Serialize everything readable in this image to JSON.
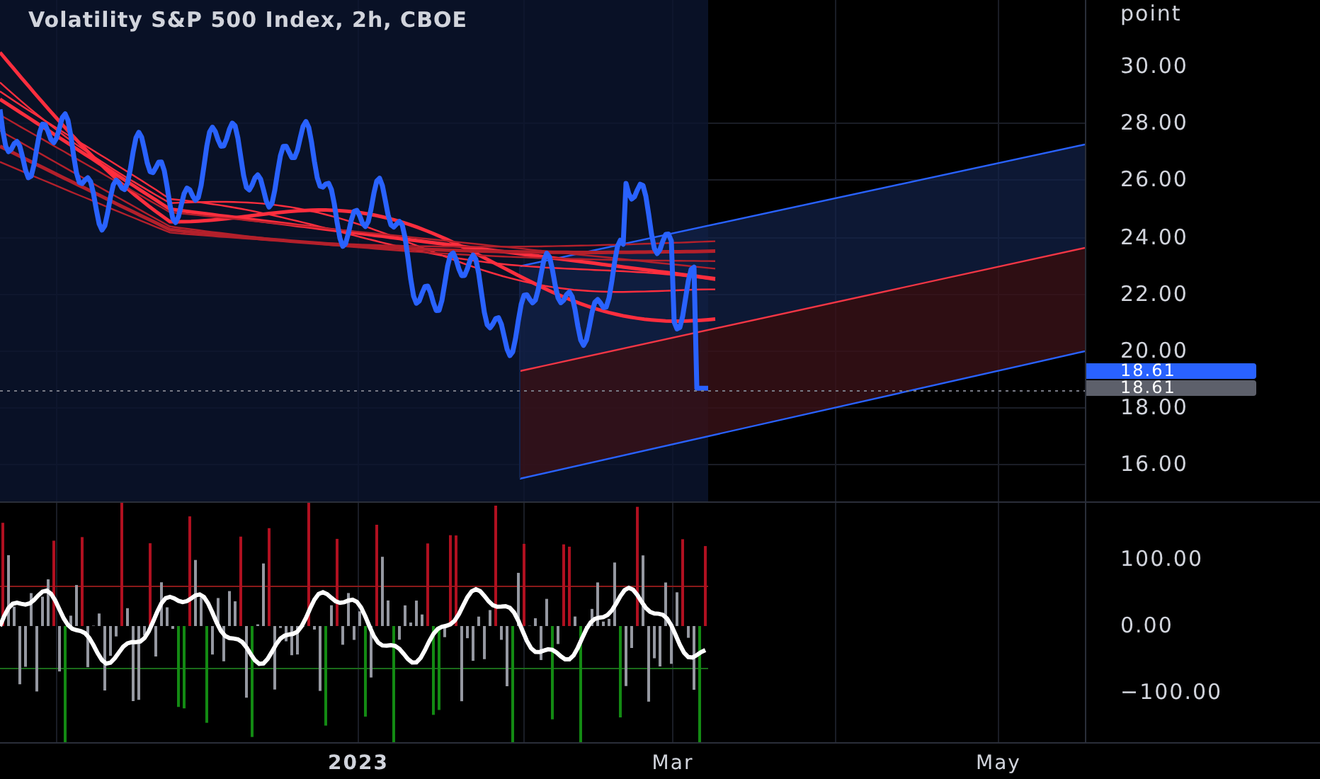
{
  "title": "Volatility S&P 500 Index, 2h, CBOE",
  "price_axis": {
    "unit": "point",
    "ticks": [
      "30.00",
      "28.00",
      "26.00",
      "24.00",
      "22.00",
      "20.00",
      "18.00",
      "16.00"
    ]
  },
  "price_tags": [
    {
      "text": "18.61",
      "kind": "last"
    },
    {
      "text": "18.61",
      "kind": "close"
    }
  ],
  "oscillator_axis": {
    "ticks": [
      "100.00",
      "0.00",
      "−100.00"
    ]
  },
  "time_axis": [
    {
      "label": "2023",
      "bold": true
    },
    {
      "label": "Mar",
      "bold": false
    },
    {
      "label": "May",
      "bold": false
    }
  ]
}
